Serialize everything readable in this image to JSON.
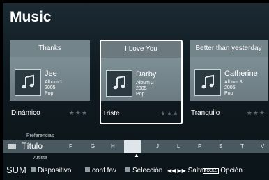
{
  "header": {
    "title": "Music"
  },
  "cards": [
    {
      "title": "Thanks",
      "artist": "Jee",
      "album": "Album 1",
      "year": "2005",
      "genre": "Pop",
      "mood": "Dinámico",
      "stars": "★★★"
    },
    {
      "title": "I Love You",
      "artist": "Darby",
      "album": "Album 2",
      "year": "2005",
      "genre": "Pop",
      "mood": "Triste",
      "stars": "★★★"
    },
    {
      "title": "Better than yesterday",
      "artist": "Catherine",
      "album": "Album 3",
      "year": "2005",
      "genre": "Pop",
      "mood": "Tranquilo",
      "stars": "★★★"
    }
  ],
  "sort": {
    "above_label": "Preferencias",
    "current": "Título",
    "below_label": "Artista",
    "letters": [
      "F",
      "G",
      "H",
      "I",
      "J",
      "L",
      "P",
      "S",
      "T",
      "V"
    ],
    "active_letter": "I",
    "pointer": "▲"
  },
  "footer": {
    "sum": "SUM",
    "device": "Dispositivo",
    "conf_fav": "conf fav",
    "selection": "Selección",
    "skip_arrows": "◀◀ ▶▶",
    "skip": "Saltar",
    "tools_badge": "TOOLS",
    "option": "Opción"
  },
  "colors": {
    "card": "#74848b",
    "background": "#13232b",
    "selected_border": "#ffffff"
  },
  "icons": {
    "thumb": "music-note-icon"
  }
}
